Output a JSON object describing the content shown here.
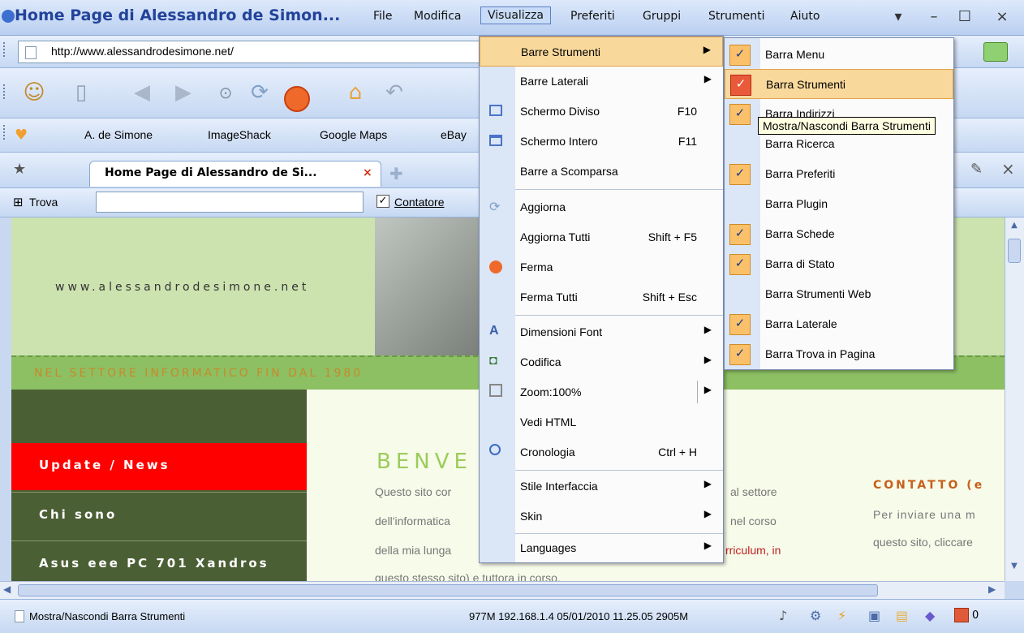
{
  "window": {
    "title": "Home Page di Alessandro de Simon...",
    "menubar": [
      "File",
      "Modifica",
      "Visualizza",
      "Preferiti",
      "Gruppi",
      "Strumenti",
      "Aiuto"
    ],
    "controls": {
      "dropdown": "▾",
      "minimize": "–",
      "maximize": "☐",
      "close": "×"
    }
  },
  "address": {
    "url": "http://www.alessandrodesimone.net/"
  },
  "favorites": [
    "A. de Simone",
    "ImageShack",
    "Google Maps",
    "eBay"
  ],
  "tab": {
    "label": "Home Page di Alessandro de Si..."
  },
  "find": {
    "label": "Trova",
    "counter_label": "Contatore"
  },
  "view_menu": {
    "items": [
      {
        "label": "Barre Strumenti",
        "submenu": true
      },
      {
        "label": "Barre Laterali",
        "submenu": true
      },
      {
        "label": "Schermo Diviso",
        "shortcut": "F10"
      },
      {
        "label": "Schermo Intero",
        "shortcut": "F11"
      },
      {
        "label": "Barre a Scomparsa"
      },
      {
        "label": "Aggiorna"
      },
      {
        "label": "Aggiorna Tutti",
        "shortcut": "Shift + F5"
      },
      {
        "label": "Ferma"
      },
      {
        "label": "Ferma Tutti",
        "shortcut": "Shift + Esc"
      },
      {
        "label": "Dimensioni Font",
        "submenu": true
      },
      {
        "label": "Codifica",
        "submenu": true
      },
      {
        "label": "Zoom:100%",
        "submenu": true
      },
      {
        "label": "Vedi HTML"
      },
      {
        "label": "Cronologia",
        "shortcut": "Ctrl + H"
      },
      {
        "label": "Stile Interfaccia",
        "submenu": true
      },
      {
        "label": "Skin",
        "submenu": true
      },
      {
        "label": "Languages",
        "submenu": true
      }
    ]
  },
  "toolbar_submenu": {
    "items": [
      {
        "label": "Barra Menu",
        "checked": true
      },
      {
        "label": "Barra Strumenti",
        "checked": true
      },
      {
        "label": "Barra Indirizzi",
        "checked": true
      },
      {
        "label": "Barra Ricerca",
        "checked": false
      },
      {
        "label": "Barra Preferiti",
        "checked": true
      },
      {
        "label": "Barra Plugin",
        "checked": false
      },
      {
        "label": "Barra Schede",
        "checked": true
      },
      {
        "label": "Barra di Stato",
        "checked": true
      },
      {
        "label": "Barra Strumenti Web",
        "checked": false
      },
      {
        "label": "Barra Laterale",
        "checked": true
      },
      {
        "label": "Barra Trova in Pagina",
        "checked": true
      }
    ],
    "check_mark": "✓"
  },
  "tooltip": "Mostra/Nascondi Barra Strumenti",
  "page": {
    "site_url": "www.alessandrodesimone.net",
    "tagline": "NEL SETTORE INFORMATICO FIN DAL 1980",
    "nav": [
      "Update / News",
      "Chi sono",
      "Asus eee PC 701 Xandros"
    ],
    "welcome_heading": "BENVE",
    "welcome_lines": [
      "Questo sito cor",
      "dell'informatica",
      "della mia lunga",
      "questo stesso sito) e tuttora in corso."
    ],
    "side_lines": [
      "al settore",
      "nel corso",
      "rriculum, in"
    ],
    "contact_heading": "CONTATTO (e",
    "contact_lines": [
      "Per inviare una m",
      "questo sito, cliccare"
    ]
  },
  "status": {
    "text": "Mostra/Nascondi Barra Strumenti",
    "info": "977M 192.168.1.4 05/01/2010 11.25.05 2905M",
    "counter": "0"
  },
  "colors": {
    "highlight": "#f9d89c",
    "green_band": "#8cc063",
    "olive": "#4b5f34",
    "red_nav": "#ff0000",
    "annotation": "#ff0000"
  }
}
